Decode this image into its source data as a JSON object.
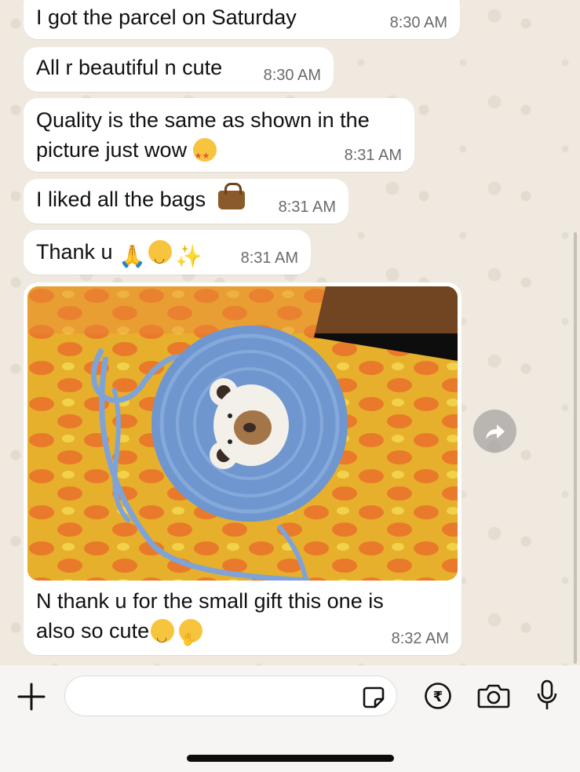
{
  "messages": [
    {
      "text": "I got the parcel on Saturday",
      "time": "8:30 AM"
    },
    {
      "text": "All r beautiful n cute",
      "time": "8:30 AM"
    },
    {
      "text_line1": "Quality is the same as shown in the",
      "text_line2": "picture just wow",
      "emoji": "star-struck-emoji",
      "time": "8:31 AM"
    },
    {
      "text": "I liked all the bags",
      "emoji": "handbag-emoji",
      "time": "8:31 AM"
    },
    {
      "text": "Thank u",
      "emojis": [
        "folded-hands-emoji",
        "smiling-face-emoji",
        "sparkles-emoji"
      ],
      "time": "8:31 AM"
    },
    {
      "image": "crochet-bear-bag-photo",
      "caption_line1": "N thank u for the small gift this one is",
      "caption_line2": "also so cute",
      "emojis": [
        "smiling-face-emoji",
        "hugging-face-emoji"
      ],
      "time": "8:32 AM"
    }
  ],
  "composer": {
    "icons": [
      "plus-icon",
      "sticker-icon",
      "rupee-icon",
      "camera-icon",
      "microphone-icon"
    ]
  },
  "colors": {
    "bubble": "#ffffff",
    "chat_background": "#efe9df",
    "timestamp": "#6b6b6b",
    "forward_button": "#8c8c8c"
  }
}
